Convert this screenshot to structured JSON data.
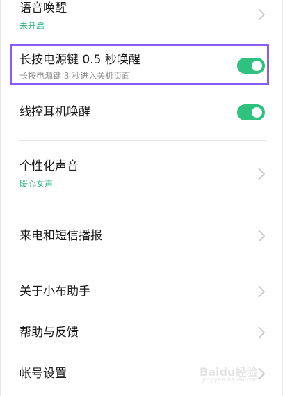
{
  "settings": {
    "voice_wakeup": {
      "title": "语音唤醒",
      "status": "未开启"
    },
    "power_key_wakeup": {
      "title": "长按电源键 0.5 秒唤醒",
      "description": "长按电源键 3 秒进入关机页面",
      "enabled": true
    },
    "wired_earphone_wakeup": {
      "title": "线控耳机唤醒",
      "enabled": true
    },
    "personalized_voice": {
      "title": "个性化声音",
      "value": "暖心女声"
    },
    "call_sms_broadcast": {
      "title": "来电和短信播报"
    },
    "about": {
      "title": "关于小布助手"
    },
    "help_feedback": {
      "title": "帮助与反馈"
    },
    "account": {
      "title": "帐号设置"
    }
  },
  "watermark": {
    "logo": "Baidu经验",
    "url": "jingyan.baidu.com"
  },
  "colors": {
    "accent_green": "#2ec27e",
    "subtitle_green": "#2fb87b",
    "highlight_border": "#8a5cf5"
  }
}
